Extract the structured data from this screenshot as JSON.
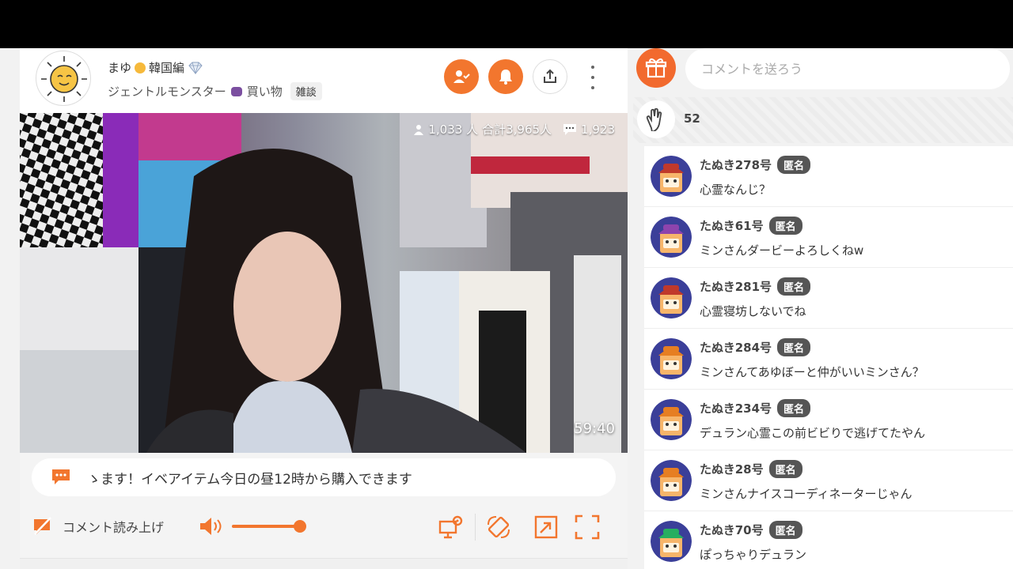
{
  "header": {
    "name": "まゆ",
    "region_label": "韓国編",
    "subtitle": "ジェントルモンスター",
    "subtitle2": "買い物",
    "category_tag": "雑談"
  },
  "video": {
    "viewers": "1,033 人",
    "total": "合計3,965人",
    "comment_count": "1,923",
    "timer": "59:40"
  },
  "ticker": {
    "text": "ゝます！イベアイテム今日の昼12時から購入できます"
  },
  "controls": {
    "read_comments_label": "コメント読み上げ",
    "volume_level": 0.95
  },
  "comment_box": {
    "placeholder": "コメントを送ろう"
  },
  "claps": {
    "count": "52"
  },
  "badge_label": "匿名",
  "colors": {
    "accent": "#f2762e",
    "badge": "#555555"
  },
  "comments": [
    {
      "name": "たぬき278号",
      "text": "心霊なんじ？",
      "hat": "#c0392b"
    },
    {
      "name": "たぬき61号",
      "text": "ミンさんダービーよろしくねw",
      "hat": "#8e44ad"
    },
    {
      "name": "たぬき281号",
      "text": "心霊寝坊しないでね",
      "hat": "#c0392b"
    },
    {
      "name": "たぬき284号",
      "text": "ミンさんてあゆぼーと仲がいいミンさん？",
      "hat": "#e67e22"
    },
    {
      "name": "たぬき234号",
      "text": "デュラン心霊この前ビビりで逃げてたやん",
      "hat": "#e67e22"
    },
    {
      "name": "たぬき28号",
      "text": "ミンさんナイスコーディネーターじゃん",
      "hat": "#e67e22"
    },
    {
      "name": "たぬき70号",
      "text": "ぽっちゃりデュラン",
      "hat": "#27ae60"
    }
  ]
}
